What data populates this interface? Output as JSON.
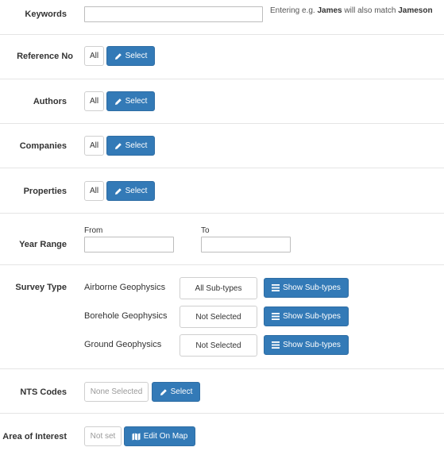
{
  "keywords": {
    "label": "Keywords",
    "value": "",
    "help_prefix": "Entering e.g. ",
    "help_example": "James",
    "help_middle": " will also match ",
    "help_match": "Jameson"
  },
  "reference_no": {
    "label": "Reference No",
    "all_label": "All",
    "select_label": "Select"
  },
  "authors": {
    "label": "Authors",
    "all_label": "All",
    "select_label": "Select"
  },
  "companies": {
    "label": "Companies",
    "all_label": "All",
    "select_label": "Select"
  },
  "properties": {
    "label": "Properties",
    "all_label": "All",
    "select_label": "Select"
  },
  "year_range": {
    "label": "Year Range",
    "from_label": "From",
    "from_value": "",
    "to_label": "To",
    "to_value": ""
  },
  "survey_type": {
    "label": "Survey Type",
    "rows": [
      {
        "name": "Airborne Geophysics",
        "status": "All Sub-types",
        "button": "Show Sub-types"
      },
      {
        "name": "Borehole Geophysics",
        "status": "Not Selected",
        "button": "Show Sub-types"
      },
      {
        "name": "Ground Geophysics",
        "status": "Not Selected",
        "button": "Show Sub-types"
      }
    ]
  },
  "nts_codes": {
    "label": "NTS Codes",
    "status": "None Selected",
    "select_label": "Select"
  },
  "area_of_interest": {
    "label": "Area of Interest",
    "status": "Not set",
    "button_label": "Edit On Map"
  },
  "colors": {
    "primary": "#337ab7",
    "border": "#cfcfcf",
    "separator": "#e5e5e5"
  }
}
